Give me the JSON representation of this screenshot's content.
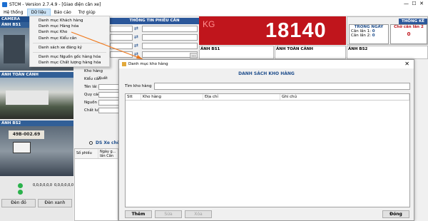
{
  "window": {
    "title": "STCM - Version 2.7.4.9 - [Giao diện cân xe]"
  },
  "menu": [
    "Hệ thống",
    "Dữ liệu",
    "Báo cáo",
    "Trợ giúp"
  ],
  "dropdown": {
    "items": [
      "Danh mục Khách hàng",
      "Danh mục Hàng hóa",
      "Danh mục Kho",
      "Danh mục Kiểu cân",
      "Danh sách xe đăng ký",
      "Danh mục Nguồn gốc hàng hóa",
      "Danh mục Chất lượng hàng hóa"
    ]
  },
  "left": {
    "camera_label": "CAMERA",
    "anh_bs1": "ẢNH BS1",
    "anh_toan_canh": "ẢNH TOÀN CẢNH",
    "anh_bs2": "ẢNH BS2",
    "plate_text": "49B-002.69",
    "coords_a": "0,0,0,0,0,0",
    "coords_b": "0,0,0,0,0,0",
    "btn_red": "Đèn đỏ",
    "btn_green": "Đèn xanh"
  },
  "form": {
    "header": "THÔNG TIN PHIẾU CÂN",
    "labels": [
      "Kho hàng",
      "Kiểu cân",
      "Tên lái xe",
      "Quy cách",
      "Nguồn gốc",
      "Chất lượng"
    ],
    "kieu_can_value": "Xuất",
    "ds_xe": "DS Xe chờ",
    "col_so_phieu": "Số phiếu",
    "col_ngay": "Ngày g... lần Cân"
  },
  "scale": {
    "unit": "KG",
    "value": "18140",
    "anh_bs1": "ẢNH BS1",
    "anh_toan_canh": "ẢNH TOÀN CẢNH",
    "anh_bs2": "ẢNH BS2"
  },
  "stats": {
    "title": "THỐNG KÊ",
    "trong_ngay": "TRONG NGÀY",
    "can_lan_1": "Cân lần 1:",
    "can_lan_1_val": "0",
    "can_lan_2": "Cân lần 2:",
    "can_lan_2_val": "0",
    "cho_can": "Chờ cân lần 2",
    "cho_can_val": "0"
  },
  "dialog": {
    "title": "Danh mục kho hàng",
    "heading": "DANH SÁCH KHO HÀNG",
    "search_label": "Tìm kho hàng",
    "search_value": "",
    "columns": [
      "Stt",
      "Kho hàng",
      "Địa chỉ",
      "Ghi chú"
    ],
    "btn_add": "Thêm",
    "btn_edit": "Sửa",
    "btn_delete": "Xóa",
    "btn_close": "Đóng"
  },
  "colors": {
    "accent": "#2b579a",
    "scale_bg": "#c0151c",
    "title_blue": "#1f4e8c"
  }
}
